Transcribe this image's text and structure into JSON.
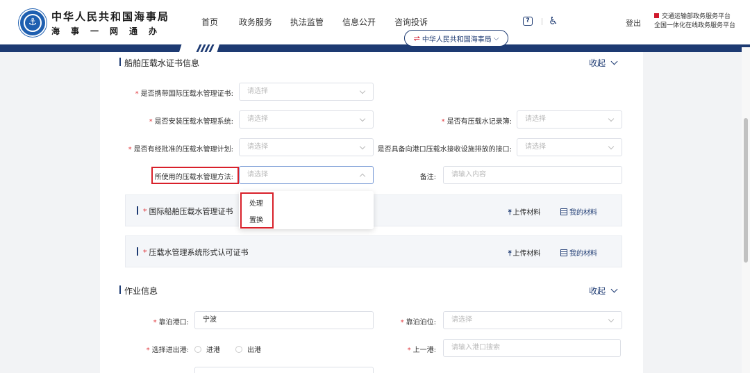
{
  "header": {
    "brand_name": "中华人民共和国海事局",
    "brand_sub": "海事一网通办",
    "nav": [
      "首页",
      "政务服务",
      "执法监管",
      "信息公开",
      "咨询投诉"
    ],
    "org_selector": "中华人民共和国海事局",
    "logout": "登出",
    "platform_line1": "交通运输部政务服务平台",
    "platform_line2": "全国一体化在线政务服务平台"
  },
  "ballast_section": {
    "title": "船舶压载水证书信息",
    "collapse_label": "收起",
    "fields": {
      "carry_cert_label": "是否携带国际压载水管理证书:",
      "carry_cert_placeholder": "请选择",
      "install_system_label": "是否安装压载水管理系统:",
      "install_system_placeholder": "请选择",
      "record_book_label": "是否有压载水记录簿:",
      "record_book_placeholder": "请选择",
      "approved_plan_label": "是否有经批准的压载水管理计划:",
      "approved_plan_placeholder": "请选择",
      "port_interface_label": "是否具备向港口压载水接收设施排放的接口:",
      "port_interface_placeholder": "请选择",
      "method_label": "所使用的压载水管理方法:",
      "method_placeholder": "请选择",
      "remarks_label": "备注:",
      "remarks_placeholder": "请输入内容"
    },
    "method_options": [
      "处理",
      "置换"
    ],
    "certs": [
      {
        "title": "国际船舶压载水管理证书",
        "upload": "上传材料",
        "mine": "我的材料"
      },
      {
        "title": "压载水管理系统形式认可证书",
        "upload": "上传材料",
        "mine": "我的材料"
      }
    ]
  },
  "work_section": {
    "title": "作业信息",
    "collapse_label": "收起",
    "berth_port_label": "靠泊港口:",
    "berth_port_value": "宁波",
    "berth_position_label": "靠泊泊位:",
    "berth_position_placeholder": "请选择",
    "direction_label": "选择进出港:",
    "direction_options": [
      "进港",
      "出港"
    ],
    "last_port_label": "上一港:",
    "last_port_placeholder": "请输入港口搜索"
  },
  "colors": {
    "primary": "#1d3a72",
    "required": "#e0393e",
    "highlight": "#d8202a"
  }
}
